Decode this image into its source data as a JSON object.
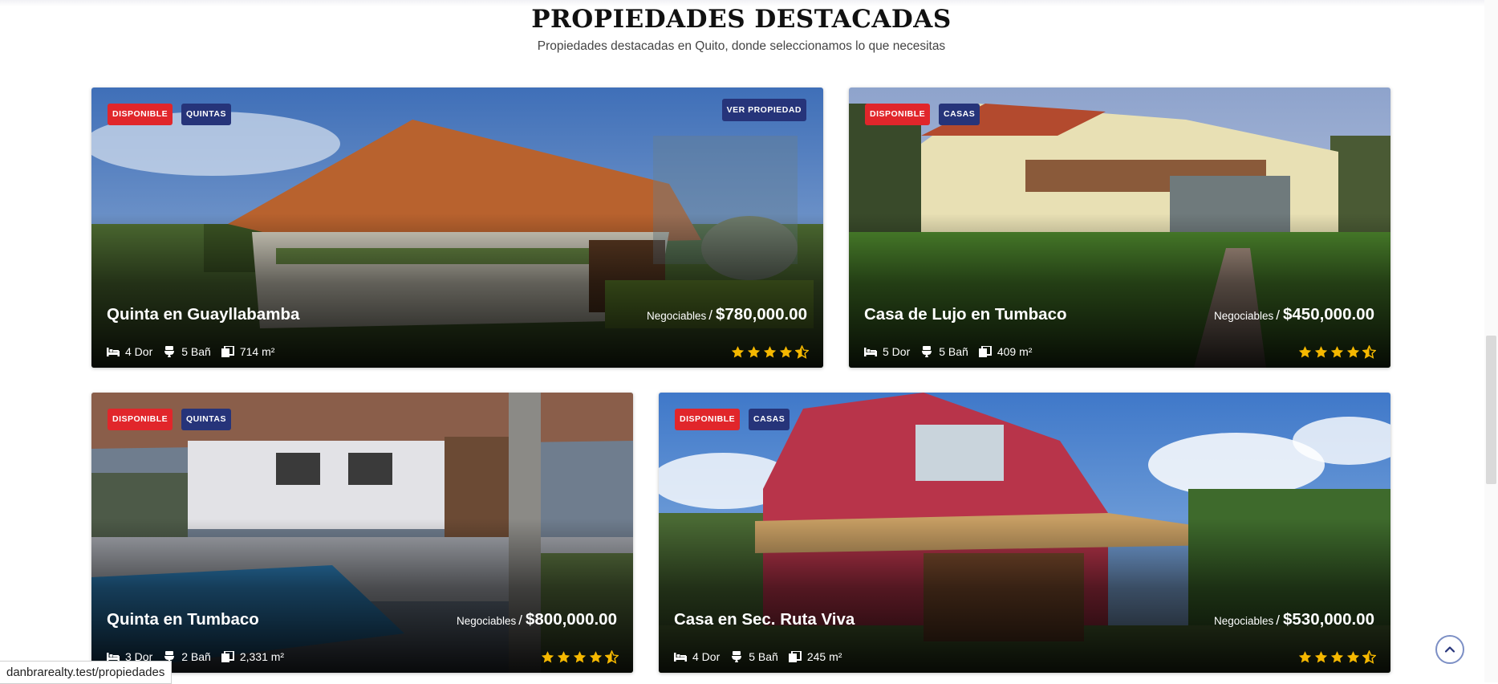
{
  "section": {
    "title": "PROPIEDADES DESTACADAS",
    "subtitle": "Propiedades destacadas en Quito, donde seleccionamos lo que necesitas"
  },
  "properties": [
    {
      "status": "DISPONIBLE",
      "category": "QUINTAS",
      "view_button": "VER PROPIEDAD",
      "title": "Quinta en Guayllabamba",
      "price_label": "Negociables",
      "price_separator": "/",
      "price": "$780,000.00",
      "bedrooms": "4 Dor",
      "bathrooms": "5 Bañ",
      "area": "714 m²",
      "rating": 4.5
    },
    {
      "status": "DISPONIBLE",
      "category": "CASAS",
      "title": "Casa de Lujo en Tumbaco",
      "price_label": "Negociables",
      "price_separator": "/",
      "price": "$450,000.00",
      "bedrooms": "5 Dor",
      "bathrooms": "5 Bañ",
      "area": "409 m²",
      "rating": 4.5
    },
    {
      "status": "DISPONIBLE",
      "category": "QUINTAS",
      "title": "Quinta en Tumbaco",
      "price_label": "Negociables",
      "price_separator": "/",
      "price": "$800,000.00",
      "bedrooms": "3 Dor",
      "bathrooms": "2 Bañ",
      "area": "2,331 m²",
      "rating": 4.5
    },
    {
      "status": "DISPONIBLE",
      "category": "CASAS",
      "title": "Casa en Sec. Ruta Viva",
      "price_label": "Negociables",
      "price_separator": "/",
      "price": "$530,000.00",
      "bedrooms": "4 Dor",
      "bathrooms": "5 Bañ",
      "area": "245 m²",
      "rating": 4.5
    }
  ],
  "status_bar": {
    "url": "danbrarealty.test/propiedades"
  },
  "colors": {
    "status_badge": "#e1262b",
    "category_badge": "#26347a",
    "star": "#f5b800"
  },
  "icons": {
    "bedrooms": "bed-icon",
    "bathrooms": "toilet-icon",
    "area": "copy-area-icon",
    "back_to_top": "chevron-up-icon"
  }
}
